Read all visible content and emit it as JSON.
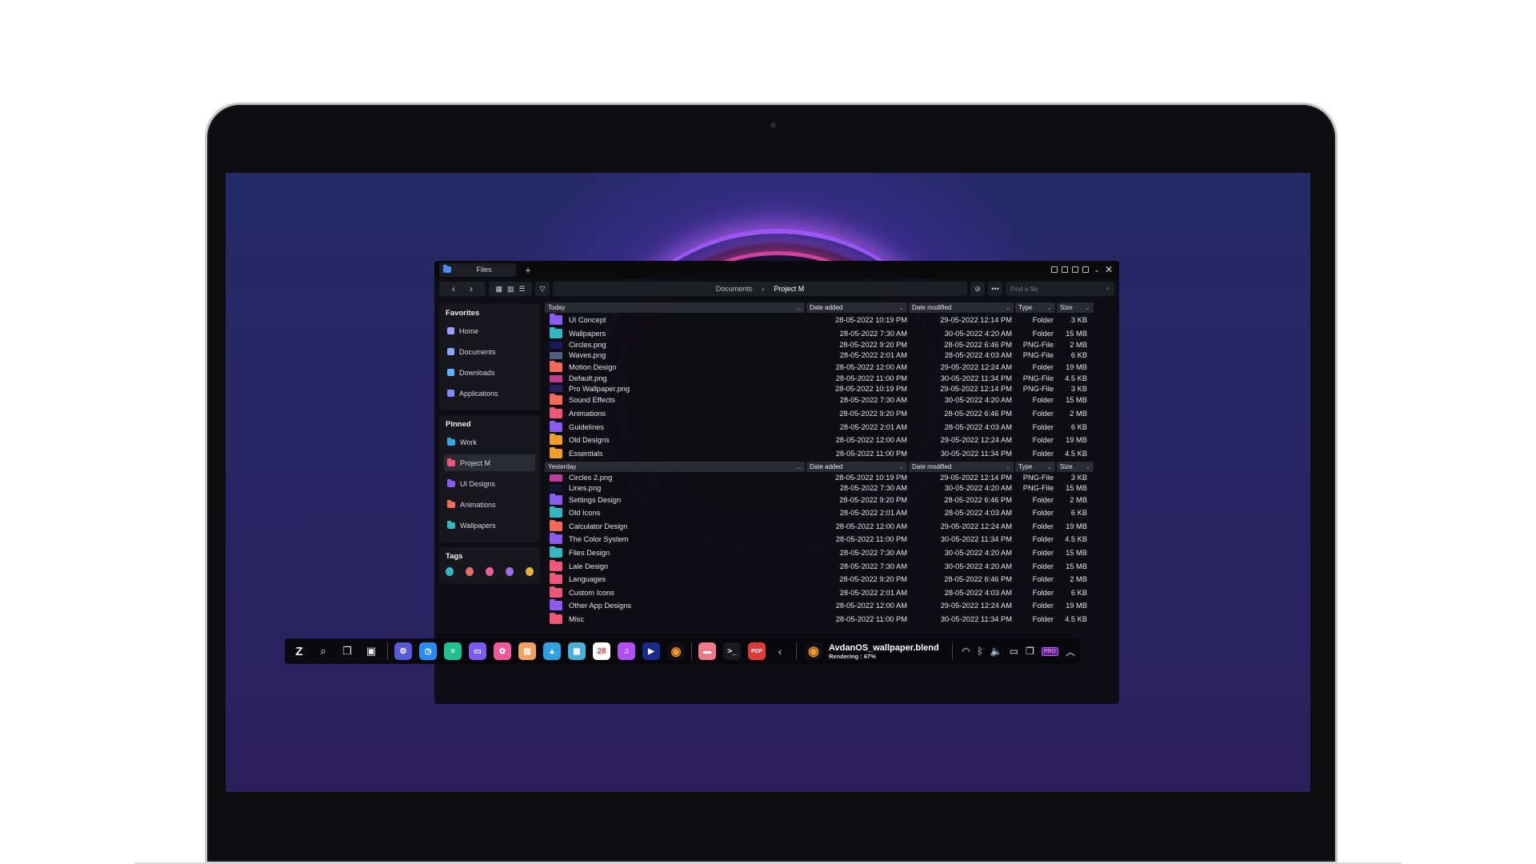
{
  "window": {
    "tab_title": "Files",
    "new_tab": "+",
    "breadcrumb": [
      "Documents",
      "Project M"
    ],
    "search_placeholder": "Find a file"
  },
  "sidebar": {
    "favorites_title": "Favorites",
    "favorites": [
      {
        "label": "Home",
        "icon": "home-icon",
        "color": "#9aa0ff"
      },
      {
        "label": "Documents",
        "icon": "document-icon",
        "color": "#8aa4ff"
      },
      {
        "label": "Downloads",
        "icon": "download-icon",
        "color": "#5ab4ff"
      },
      {
        "label": "Applications",
        "icon": "apps-icon",
        "color": "#7f8cff"
      }
    ],
    "pinned_title": "Pinned",
    "pinned": [
      {
        "label": "Work",
        "color": "#3aa6e0"
      },
      {
        "label": "Project M",
        "color": "#f0567a"
      },
      {
        "label": "UI Designs",
        "color": "#8a5cf0"
      },
      {
        "label": "Animations",
        "color": "#f26a5a"
      },
      {
        "label": "Wallpapers",
        "color": "#2fb8c0"
      }
    ],
    "tags_title": "Tags",
    "tags": [
      "#37b6c4",
      "#e0716a",
      "#ea5fa0",
      "#9a6ee8",
      "#e5b23a"
    ]
  },
  "columns": {
    "added": "Date added",
    "modified": "Date modified",
    "type": "Type",
    "size": "Size"
  },
  "groups": [
    {
      "title": "Today",
      "rows": [
        {
          "name": "UI Concept",
          "kind": "folder",
          "color": "#8a5cf0",
          "added": "28-05-2022 10:19 PM",
          "modified": "29-05-2022 12:14 PM",
          "type": "Folder",
          "size": "3 KB"
        },
        {
          "name": "Wallpapers",
          "kind": "folder",
          "color": "#2fb8c0",
          "added": "28-05-2022 7:30 AM",
          "modified": "30-05-2022 4:20 AM",
          "type": "Folder",
          "size": "15 MB"
        },
        {
          "name": "Circles.png",
          "kind": "image",
          "color": "#1a1a5a",
          "added": "28-05-2022 9:20 PM",
          "modified": "28-05-2022 6:46 PM",
          "type": "PNG-File",
          "size": "2 MB"
        },
        {
          "name": "Waves.png",
          "kind": "image",
          "color": "#506080",
          "added": "28-05-2022 2:01 AM",
          "modified": "28-05-2022 4:03 AM",
          "type": "PNG-File",
          "size": "6 KB"
        },
        {
          "name": "Motion Design",
          "kind": "folder",
          "color": "#f26a5a",
          "added": "28-05-2022 12:00 AM",
          "modified": "29-05-2022 12:24 AM",
          "type": "Folder",
          "size": "19 MB"
        },
        {
          "name": "Default.png",
          "kind": "image",
          "color": "#c03a8a",
          "added": "28-05-2022 11:00 PM",
          "modified": "30-05-2022 11:34 PM",
          "type": "PNG-File",
          "size": "4.5 KB"
        },
        {
          "name": "Pro Wallpaper.png",
          "kind": "image",
          "color": "#2a1f60",
          "added": "28-05-2022 10:19 PM",
          "modified": "29-05-2022 12:14 PM",
          "type": "PNG-File",
          "size": "3 KB"
        },
        {
          "name": "Sound Effects",
          "kind": "folder",
          "color": "#f26a5a",
          "added": "28-05-2022 7:30 AM",
          "modified": "30-05-2022 4:20 AM",
          "type": "Folder",
          "size": "15 MB"
        },
        {
          "name": "Animations",
          "kind": "folder",
          "color": "#f0567a",
          "added": "28-05-2022 9:20 PM",
          "modified": "28-05-2022 6:46 PM",
          "type": "Folder",
          "size": "2 MB"
        },
        {
          "name": "Guidelines",
          "kind": "folder",
          "color": "#8a5cf0",
          "added": "28-05-2022 2:01 AM",
          "modified": "28-05-2022 4:03 AM",
          "type": "Folder",
          "size": "6 KB"
        },
        {
          "name": "Old Designs",
          "kind": "folder",
          "color": "#f0a028",
          "added": "28-05-2022 12:00 AM",
          "modified": "29-05-2022 12:24 AM",
          "type": "Folder",
          "size": "19 MB"
        },
        {
          "name": "Essentials",
          "kind": "folder",
          "color": "#f0a028",
          "added": "28-05-2022 11:00 PM",
          "modified": "30-05-2022 11:34 PM",
          "type": "Folder",
          "size": "4.5 KB"
        }
      ]
    },
    {
      "title": "Yesterday",
      "rows": [
        {
          "name": "Circles 2.png",
          "kind": "image",
          "color": "#c03aa0",
          "added": "28-05-2022 10:19 PM",
          "modified": "29-05-2022 12:14 PM",
          "type": "PNG-File",
          "size": "3 KB"
        },
        {
          "name": "Lines.png",
          "kind": "image",
          "color": "#151530",
          "added": "28-05-2022 7:30 AM",
          "modified": "30-05-2022 4:20 AM",
          "type": "PNG-File",
          "size": "15 MB"
        },
        {
          "name": "Settings Design",
          "kind": "folder",
          "color": "#8a5cf0",
          "added": "28-05-2022 9:20 PM",
          "modified": "28-05-2022 6:46 PM",
          "type": "Folder",
          "size": "2 MB"
        },
        {
          "name": "Old Icons",
          "kind": "folder",
          "color": "#2fb8c0",
          "added": "28-05-2022 2:01 AM",
          "modified": "28-05-2022 4:03 AM",
          "type": "Folder",
          "size": "6 KB"
        },
        {
          "name": "Calculator Design",
          "kind": "folder",
          "color": "#f26a5a",
          "added": "28-05-2022 12:00 AM",
          "modified": "29-05-2022 12:24 AM",
          "type": "Folder",
          "size": "19 MB"
        },
        {
          "name": "The Color System",
          "kind": "folder",
          "color": "#8a5cf0",
          "added": "28-05-2022 11:00 PM",
          "modified": "30-05-2022 11:34 PM",
          "type": "Folder",
          "size": "4.5 KB"
        },
        {
          "name": "Files Design",
          "kind": "folder",
          "color": "#2fb8c0",
          "added": "28-05-2022 7:30 AM",
          "modified": "30-05-2022 4:20 AM",
          "type": "Folder",
          "size": "15 MB"
        },
        {
          "name": "Lale Design",
          "kind": "folder",
          "color": "#f0567a",
          "added": "28-05-2022 7:30 AM",
          "modified": "30-05-2022 4:20 AM",
          "type": "Folder",
          "size": "15 MB"
        },
        {
          "name": "Languages",
          "kind": "folder",
          "color": "#f0567a",
          "added": "28-05-2022 9:20 PM",
          "modified": "28-05-2022 6:46 PM",
          "type": "Folder",
          "size": "2 MB"
        },
        {
          "name": "Custom Icons",
          "kind": "folder",
          "color": "#f0567a",
          "added": "28-05-2022 2:01 AM",
          "modified": "28-05-2022 4:03 AM",
          "type": "Folder",
          "size": "6 KB"
        },
        {
          "name": "Other App Designs",
          "kind": "folder",
          "color": "#8a5cf0",
          "added": "28-05-2022 12:00 AM",
          "modified": "29-05-2022 12:24 AM",
          "type": "Folder",
          "size": "19 MB"
        },
        {
          "name": "Misc",
          "kind": "folder",
          "color": "#f0567a",
          "added": "28-05-2022 11:00 PM",
          "modified": "30-05-2022 11:34 PM",
          "type": "Folder",
          "size": "4.5 KB"
        }
      ]
    }
  ],
  "taskbar": {
    "apps": [
      {
        "name": "settings-app-icon",
        "color": "#5a5ad8",
        "glyph": "⚙"
      },
      {
        "name": "clock-app-icon",
        "color": "#2a8cf0",
        "glyph": "◷"
      },
      {
        "name": "messages-app-icon",
        "color": "#20c090",
        "glyph": "≡"
      },
      {
        "name": "mail-app-icon",
        "color": "#7a5cf0",
        "glyph": "▭"
      },
      {
        "name": "photos-app-icon",
        "color": "#f05a9a",
        "glyph": "✿"
      },
      {
        "name": "notes-app-icon",
        "color": "#f0a060",
        "glyph": "▤"
      },
      {
        "name": "gallery-app-icon",
        "color": "#30a0e0",
        "glyph": "▲"
      },
      {
        "name": "calculator-app-icon",
        "color": "#4ab0d8",
        "glyph": "▦"
      },
      {
        "name": "calendar-app-icon",
        "color": "#ffffff",
        "glyph": "28"
      },
      {
        "name": "music-app-icon",
        "color": "#b050f0",
        "glyph": "♫"
      },
      {
        "name": "video-player-app-icon",
        "color": "#1a2a8a",
        "glyph": "▶"
      },
      {
        "name": "blender-app-icon",
        "color": "#101014",
        "glyph": "◉"
      }
    ],
    "apps2": [
      {
        "name": "files-app-icon",
        "color": "#f07a8a",
        "glyph": "▬"
      },
      {
        "name": "terminal-app-icon",
        "color": "#1a1a1e",
        "glyph": ">_"
      },
      {
        "name": "pdf-app-icon",
        "color": "#e03a3a",
        "glyph": "PDF"
      }
    ],
    "render_title": "AvdanOS_wallpaper.blend",
    "render_status": "Rendering :  67%",
    "render_progress": 0.67,
    "pro_badge": "PRO"
  }
}
